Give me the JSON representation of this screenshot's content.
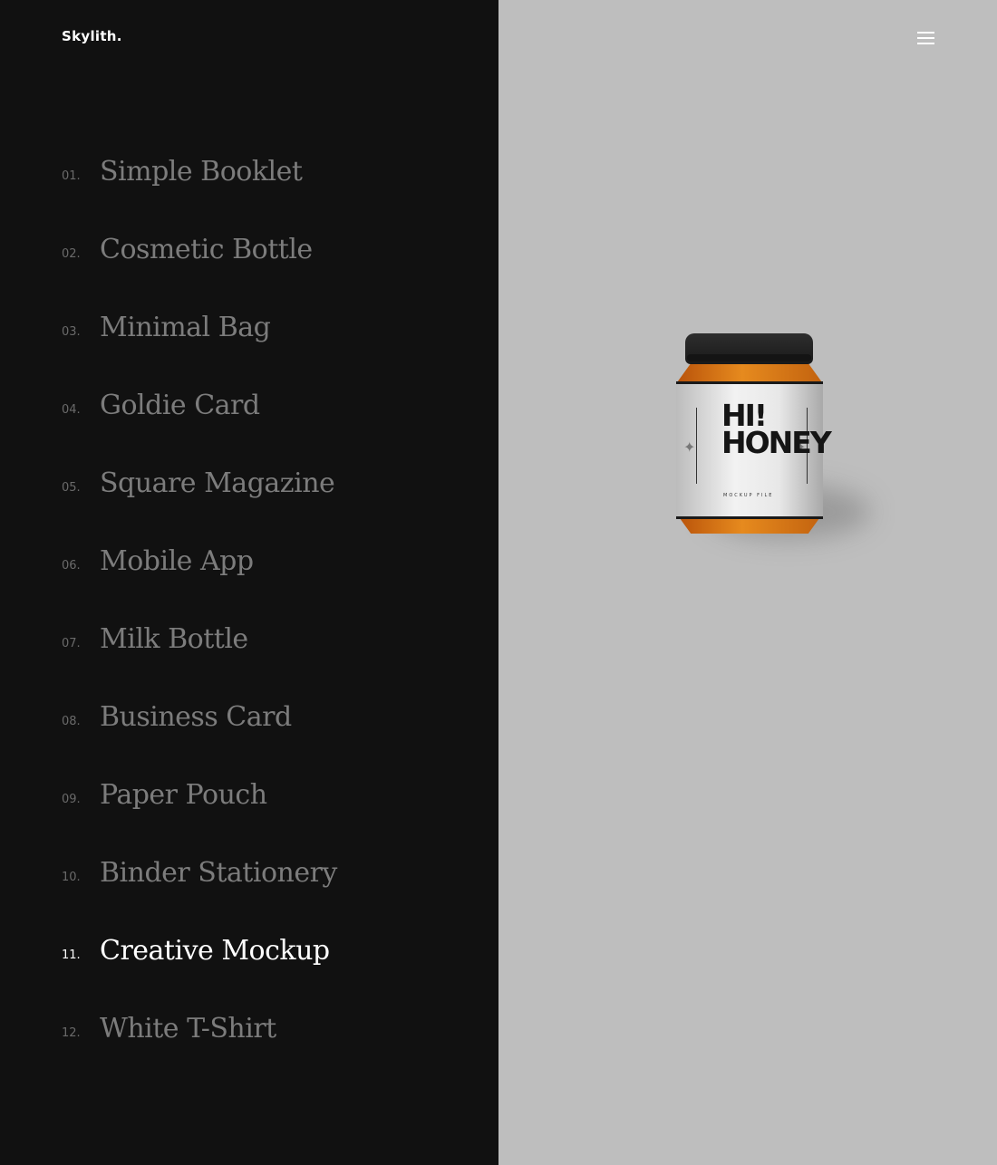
{
  "brand": {
    "logo": "Skylith."
  },
  "header": {
    "menu_icon": "hamburger-icon"
  },
  "projects": [
    {
      "number": "01.",
      "title": "Simple Booklet",
      "active": false
    },
    {
      "number": "02.",
      "title": "Cosmetic Bottle",
      "active": false
    },
    {
      "number": "03.",
      "title": "Minimal Bag",
      "active": false
    },
    {
      "number": "04.",
      "title": "Goldie Card",
      "active": false
    },
    {
      "number": "05.",
      "title": "Square Magazine",
      "active": false
    },
    {
      "number": "06.",
      "title": "Mobile App",
      "active": false
    },
    {
      "number": "07.",
      "title": "Milk Bottle",
      "active": false
    },
    {
      "number": "08.",
      "title": "Business Card",
      "active": false
    },
    {
      "number": "09.",
      "title": "Paper Pouch",
      "active": false
    },
    {
      "number": "10.",
      "title": "Binder Stationery",
      "active": false
    },
    {
      "number": "11.",
      "title": "Creative Mockup",
      "active": true
    },
    {
      "number": "12.",
      "title": "White T-Shirt",
      "active": false
    }
  ],
  "preview": {
    "label_title": "HI!\nHONEY",
    "label_subtitle": "MOCKUP FILE"
  },
  "colors": {
    "left_panel": "#111111",
    "right_panel": "#bebebe",
    "inactive_text": "#7c7c7c",
    "active_text": "#ffffff",
    "honey": "#e68a1e"
  }
}
